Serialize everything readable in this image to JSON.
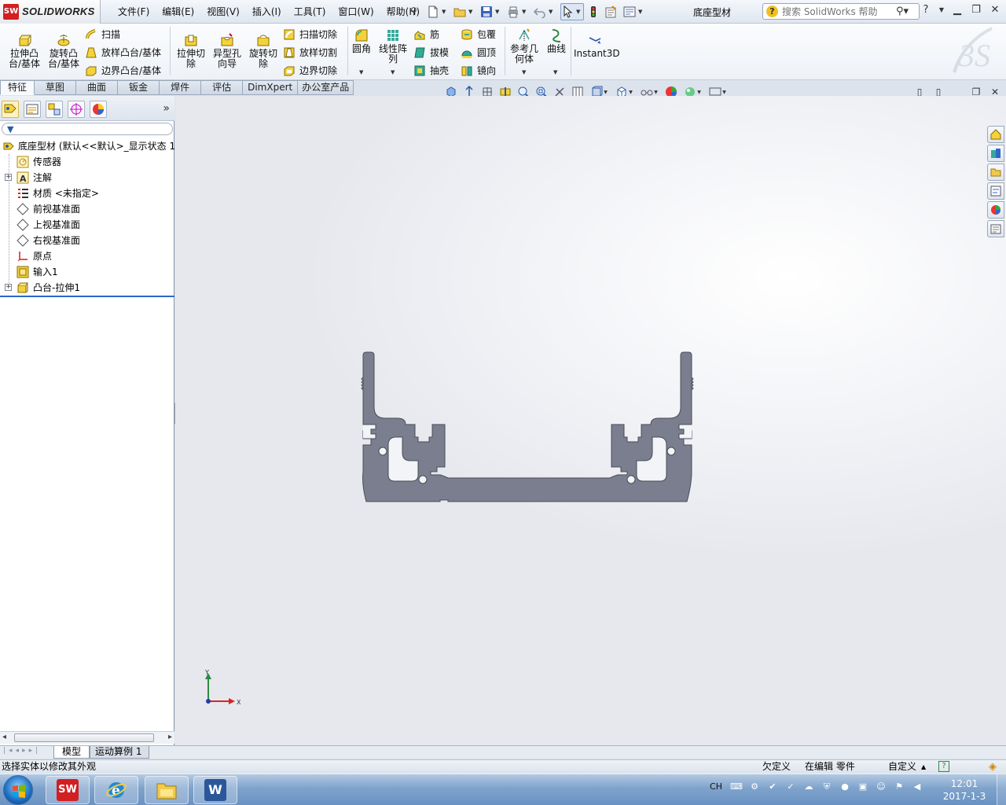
{
  "app": {
    "brand": "SOLIDWORKS",
    "document_title": "底座型材",
    "menus": [
      "文件(F)",
      "编辑(E)",
      "视图(V)",
      "插入(I)",
      "工具(T)",
      "窗口(W)",
      "帮助(H)"
    ],
    "help_search_placeholder": "搜索 SolidWorks 帮助",
    "help_label": "?"
  },
  "ribbon": {
    "big_buttons": [
      {
        "id": "extrude-boss",
        "label1": "拉伸凸",
        "label2": "台/基体"
      },
      {
        "id": "revolve-boss",
        "label1": "旋转凸",
        "label2": "台/基体"
      },
      {
        "id": "extrude-cut",
        "label1": "拉伸切",
        "label2": "除"
      },
      {
        "id": "hole-wizard",
        "label1": "异型孔",
        "label2": "向导"
      },
      {
        "id": "revolve-cut",
        "label1": "旋转切",
        "label2": "除"
      },
      {
        "id": "fillet",
        "label1": "圆角",
        "label2": ""
      },
      {
        "id": "linear-pattern",
        "label1": "线性阵",
        "label2": "列"
      },
      {
        "id": "reference-geometry",
        "label1": "参考几",
        "label2": "何体"
      },
      {
        "id": "curves",
        "label1": "曲线",
        "label2": ""
      },
      {
        "id": "instant3d",
        "label1": "Instant3D",
        "label2": ""
      }
    ],
    "small_buttons": {
      "col1": [
        "扫描",
        "放样凸台/基体",
        "边界凸台/基体"
      ],
      "col2": [
        "扫描切除",
        "放样切割",
        "边界切除"
      ],
      "col3": [
        "筋",
        "拔模",
        "抽壳"
      ],
      "col4": [
        "包覆",
        "圆顶",
        "镜向"
      ]
    }
  },
  "tabs": [
    "特征",
    "草图",
    "曲面",
    "钣金",
    "焊件",
    "评估",
    "DimXpert",
    "办公室产品"
  ],
  "active_tab": "特征",
  "tree": {
    "root": "底座型材  (默认<<默认>_显示状态 1>)",
    "items": [
      {
        "label": "传感器",
        "icon": "sensor-icon",
        "expandable": false
      },
      {
        "label": "注解",
        "icon": "annotation-icon",
        "expandable": true
      },
      {
        "label": "材质 <未指定>",
        "icon": "material-icon",
        "expandable": false
      },
      {
        "label": "前视基准面",
        "icon": "plane-icon",
        "expandable": false
      },
      {
        "label": "上视基准面",
        "icon": "plane-icon",
        "expandable": false
      },
      {
        "label": "右视基准面",
        "icon": "plane-icon",
        "expandable": false
      },
      {
        "label": "原点",
        "icon": "origin-icon",
        "expandable": false
      },
      {
        "label": "输入1",
        "icon": "import-feature-icon",
        "expandable": false
      },
      {
        "label": "凸台-拉伸1",
        "icon": "extrude-feature-icon",
        "expandable": true
      }
    ]
  },
  "triad": {
    "x_label": "X",
    "y_label": "Y"
  },
  "bottom_tabs": [
    "模型",
    "运动算例 1"
  ],
  "status": {
    "message": "选择实体以修改其外观",
    "definition": "欠定义",
    "mode": "在编辑 零件",
    "units": "自定义"
  },
  "taskbar": {
    "input_lang": "CH",
    "time": "12:01",
    "date": "2017-1-3"
  },
  "colors": {
    "solidworks_red": "#d21f22",
    "model_fill": "#7a7e8e",
    "selection_blue": "#2a66c8"
  }
}
